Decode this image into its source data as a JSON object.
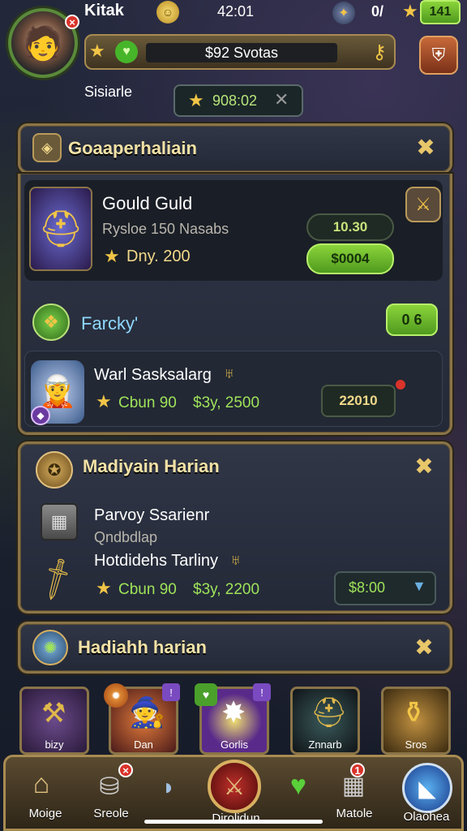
{
  "header": {
    "player_name": "Kitak",
    "timer": "42:01",
    "counter": "0/",
    "level_badge": "141",
    "currency_bar": "$92 Svotas",
    "sub_label": "Sisiarle",
    "sub_bar_value": "908:02"
  },
  "section1": {
    "title": "Goaaperhaliain",
    "item_name": "Gould Guld",
    "item_line": "Rysloe 150 Nasabs",
    "item_price": "Dny. 200",
    "value_pill": "10.30",
    "buy_pill": "$0004",
    "sub_title": "Farcky'",
    "sub_pill": "0 6",
    "hero_name": "Warl Sasksalarg",
    "hero_stat1": "Cbun 90",
    "hero_stat2": "$3y, 2500",
    "hero_pill": "22010"
  },
  "section2": {
    "title": "Madiyain Harian",
    "item1_name": "Parvoy Ssarienr",
    "item1_sub": "Qndbdlap",
    "item2_name": "Hotdidehs Tarliny",
    "item2_stat1": "Cbun 90",
    "item2_stat2": "$3y, 2200",
    "item2_pill": "$8:00"
  },
  "section3": {
    "title": "Hadiahh harian"
  },
  "cards": [
    {
      "label": "bizy"
    },
    {
      "label": "Dan"
    },
    {
      "label": "Gorlis"
    },
    {
      "label": "Znnarb"
    },
    {
      "label": "Sros"
    }
  ],
  "bottom_nav": [
    {
      "label": "Moige"
    },
    {
      "label": "Sreole"
    },
    {
      "label": ""
    },
    {
      "label": "Dirolidun"
    },
    {
      "label": ""
    },
    {
      "label": "Matole"
    },
    {
      "label": "Olaohea"
    }
  ],
  "nav_badge": "1",
  "colors": {
    "gold": "#8a7448",
    "green": "#8bd43b",
    "bg": "#1b2233"
  }
}
